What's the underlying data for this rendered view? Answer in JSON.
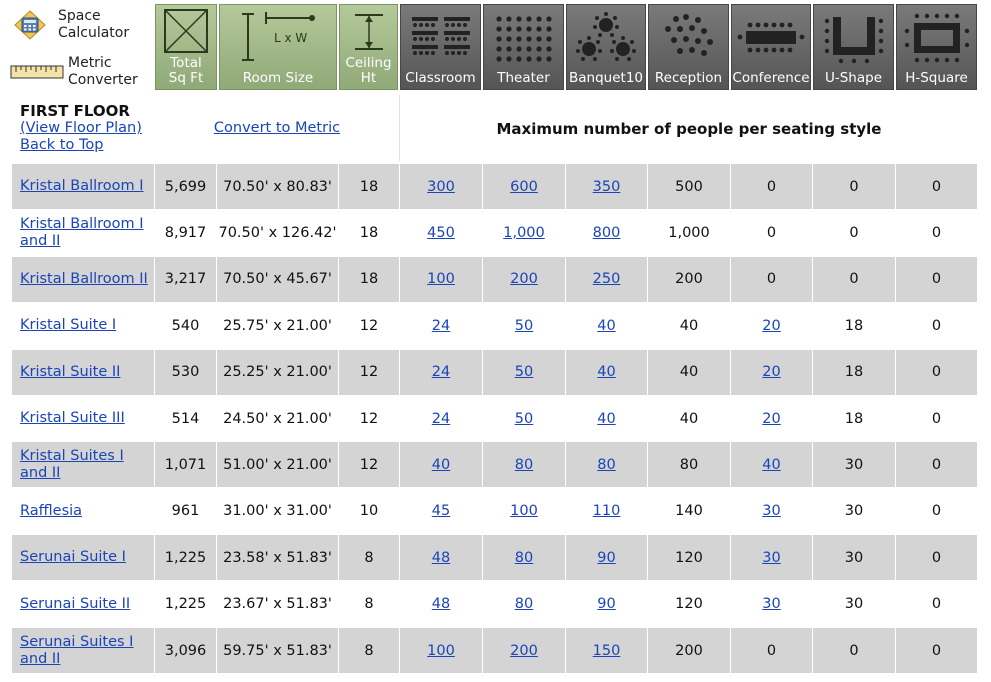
{
  "tools": {
    "space_calculator": "Space\nCalculator",
    "metric_converter": "Metric\nConverter"
  },
  "headers": [
    {
      "key": "total_sq_ft",
      "label": "Total\nSq Ft",
      "style": "green",
      "icon": "square-x-icon"
    },
    {
      "key": "room_size",
      "label": "Room Size",
      "style": "green",
      "icon": "room-dimensions-icon"
    },
    {
      "key": "ceiling_ht",
      "label": "Ceiling\nHt",
      "style": "green",
      "icon": "ceiling-height-icon"
    },
    {
      "key": "classroom",
      "label": "Classroom",
      "style": "dark",
      "icon": "classroom-layout-icon"
    },
    {
      "key": "theater",
      "label": "Theater",
      "style": "dark",
      "icon": "theater-layout-icon"
    },
    {
      "key": "banquet10",
      "label": "Banquet10",
      "style": "dark",
      "icon": "banquet-layout-icon"
    },
    {
      "key": "reception",
      "label": "Reception",
      "style": "dark",
      "icon": "reception-layout-icon"
    },
    {
      "key": "conference",
      "label": "Conference",
      "style": "dark",
      "icon": "conference-layout-icon"
    },
    {
      "key": "u_shape",
      "label": "U-Shape",
      "style": "dark",
      "icon": "u-shape-layout-icon"
    },
    {
      "key": "h_square",
      "label": "H-Square",
      "style": "dark",
      "icon": "h-square-layout-icon"
    }
  ],
  "floor": {
    "title": "FIRST FLOOR",
    "view_plan": "(View Floor Plan)",
    "back_to_top": "Back to Top",
    "convert": "Convert to Metric",
    "max_heading": "Maximum number of people per seating style"
  },
  "colors": {
    "link": "#1a44b8",
    "row_gray": "#d4d4d4",
    "header_green": "#9fb886",
    "header_dark": "#666666"
  },
  "rooms": [
    {
      "name": "Kristal Ballroom I",
      "sqft": "5,699",
      "size": "70.50' x 80.83'",
      "ceiling": "18",
      "classroom": "300",
      "theater": "600",
      "banquet": "350",
      "reception": "500",
      "conference": "0",
      "ushape": "0",
      "hsquare": "0"
    },
    {
      "name": "Kristal Ballroom I and II",
      "sqft": "8,917",
      "size": "70.50' x 126.42'",
      "ceiling": "18",
      "classroom": "450",
      "theater": "1,000",
      "banquet": "800",
      "reception": "1,000",
      "conference": "0",
      "ushape": "0",
      "hsquare": "0"
    },
    {
      "name": "Kristal Ballroom II",
      "sqft": "3,217",
      "size": "70.50' x 45.67'",
      "ceiling": "18",
      "classroom": "100",
      "theater": "200",
      "banquet": "250",
      "reception": "200",
      "conference": "0",
      "ushape": "0",
      "hsquare": "0"
    },
    {
      "name": "Kristal Suite I",
      "sqft": "540",
      "size": "25.75' x 21.00'",
      "ceiling": "12",
      "classroom": "24",
      "theater": "50",
      "banquet": "40",
      "reception": "40",
      "conference": "20",
      "ushape": "18",
      "hsquare": "0"
    },
    {
      "name": "Kristal Suite II",
      "sqft": "530",
      "size": "25.25' x 21.00'",
      "ceiling": "12",
      "classroom": "24",
      "theater": "50",
      "banquet": "40",
      "reception": "40",
      "conference": "20",
      "ushape": "18",
      "hsquare": "0"
    },
    {
      "name": "Kristal Suite III",
      "sqft": "514",
      "size": "24.50' x 21.00'",
      "ceiling": "12",
      "classroom": "24",
      "theater": "50",
      "banquet": "40",
      "reception": "40",
      "conference": "20",
      "ushape": "18",
      "hsquare": "0"
    },
    {
      "name": "Kristal Suites I and II",
      "sqft": "1,071",
      "size": "51.00' x 21.00'",
      "ceiling": "12",
      "classroom": "40",
      "theater": "80",
      "banquet": "80",
      "reception": "80",
      "conference": "40",
      "ushape": "30",
      "hsquare": "0"
    },
    {
      "name": "Rafflesia",
      "sqft": "961",
      "size": "31.00' x 31.00'",
      "ceiling": "10",
      "classroom": "45",
      "theater": "100",
      "banquet": "110",
      "reception": "140",
      "conference": "30",
      "ushape": "30",
      "hsquare": "0"
    },
    {
      "name": "Serunai Suite I",
      "sqft": "1,225",
      "size": "23.58' x 51.83'",
      "ceiling": "8",
      "classroom": "48",
      "theater": "80",
      "banquet": "90",
      "reception": "120",
      "conference": "30",
      "ushape": "30",
      "hsquare": "0"
    },
    {
      "name": "Serunai Suite II",
      "sqft": "1,225",
      "size": "23.67' x 51.83'",
      "ceiling": "8",
      "classroom": "48",
      "theater": "80",
      "banquet": "90",
      "reception": "120",
      "conference": "30",
      "ushape": "30",
      "hsquare": "0"
    },
    {
      "name": "Serunai Suites I and II",
      "sqft": "3,096",
      "size": "59.75' x 51.83'",
      "ceiling": "8",
      "classroom": "100",
      "theater": "200",
      "banquet": "150",
      "reception": "200",
      "conference": "0",
      "ushape": "0",
      "hsquare": "0"
    }
  ]
}
